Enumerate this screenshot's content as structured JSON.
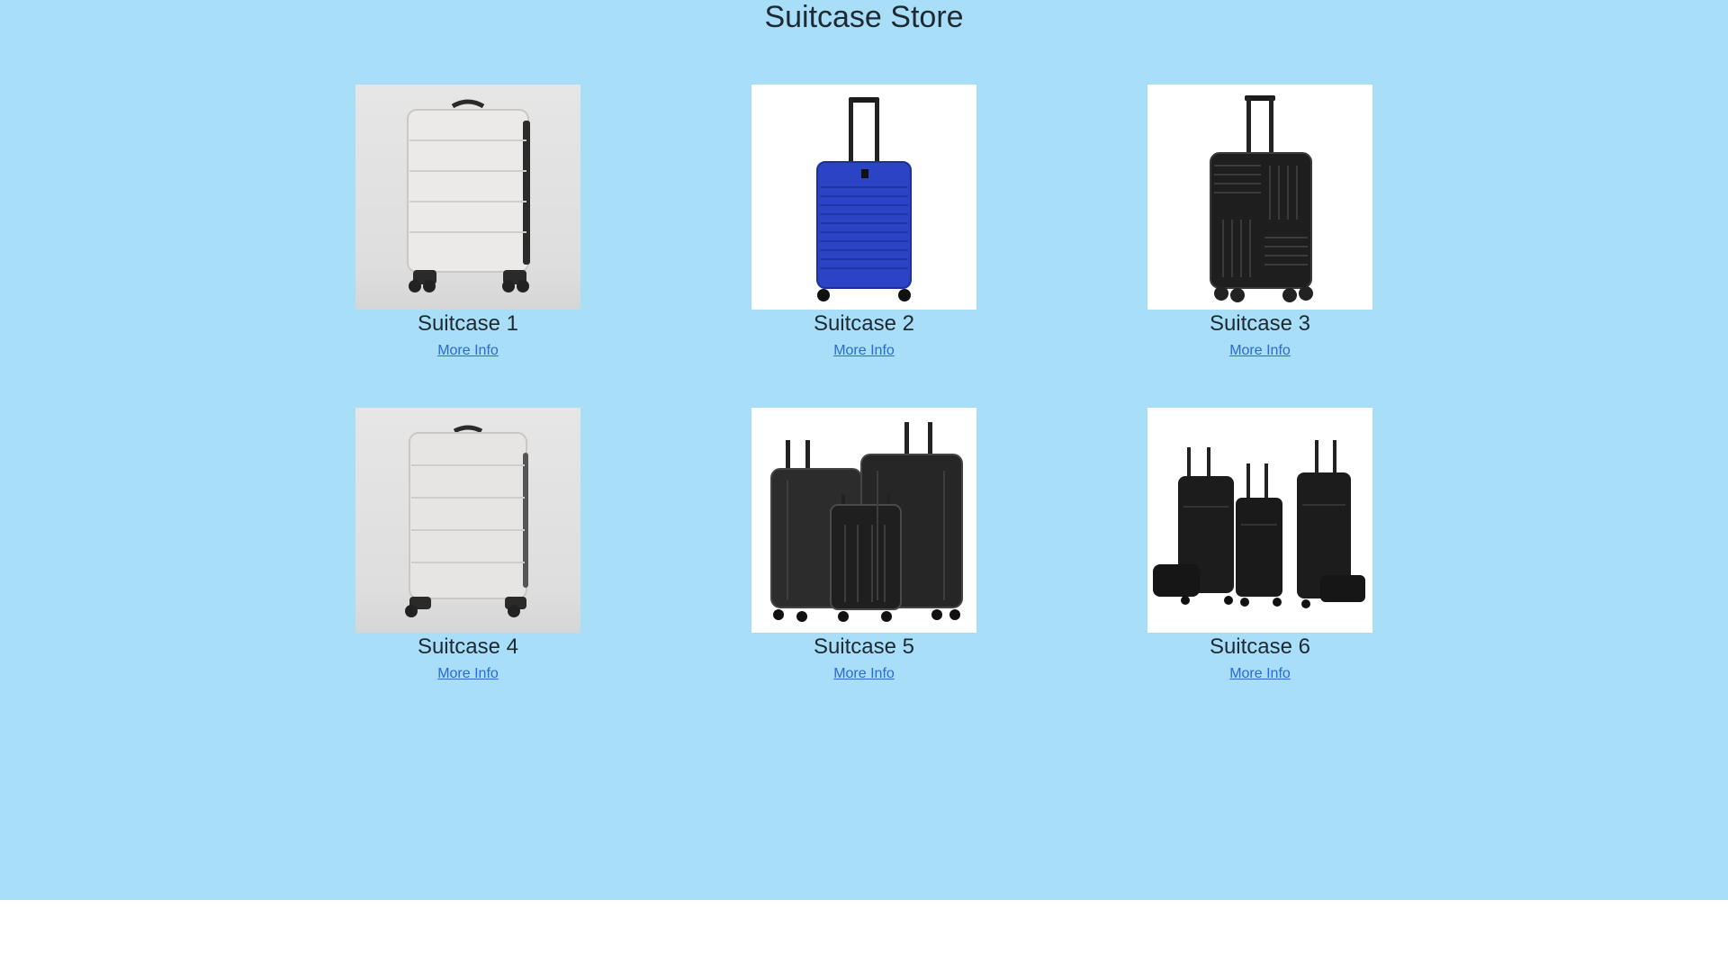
{
  "header": {
    "title": "Suitcase Store"
  },
  "products": [
    {
      "name": "Suitcase 1",
      "link": "More Info",
      "image": "white-hardshell-spinner-suitcase",
      "color": "#e9e8e6"
    },
    {
      "name": "Suitcase 2",
      "link": "More Info",
      "image": "blue-hardshell-spinner-suitcase",
      "color": "#2a46c8"
    },
    {
      "name": "Suitcase 3",
      "link": "More Info",
      "image": "black-textured-spinner-suitcase",
      "color": "#1c1c1c"
    },
    {
      "name": "Suitcase 4",
      "link": "More Info",
      "image": "white-hardshell-spinner-suitcase",
      "color": "#e6e4e2"
    },
    {
      "name": "Suitcase 5",
      "link": "More Info",
      "image": "black-hardshell-luggage-set",
      "color": "#242424"
    },
    {
      "name": "Suitcase 6",
      "link": "More Info",
      "image": "black-softside-luggage-set",
      "color": "#151515"
    }
  ]
}
